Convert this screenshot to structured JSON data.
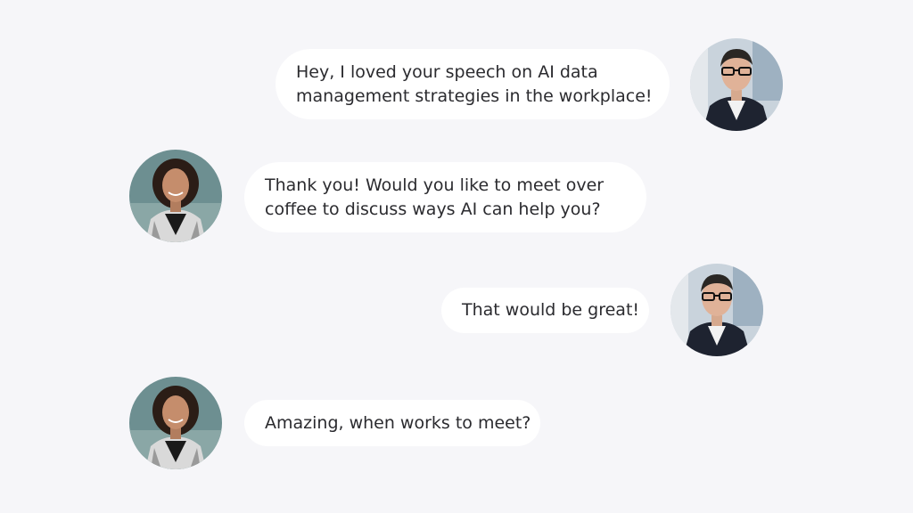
{
  "conversation": {
    "messages": [
      {
        "sender": "man",
        "lines": [
          "Hey, I loved your speech on AI data",
          "management strategies in the workplace!"
        ]
      },
      {
        "sender": "woman",
        "lines": [
          "Thank you! Would you like to meet over",
          "coffee to discuss ways AI can help you?"
        ]
      },
      {
        "sender": "man",
        "lines": [
          "That would be great!"
        ]
      },
      {
        "sender": "woman",
        "lines": [
          "Amazing, when works to meet?"
        ]
      }
    ]
  },
  "colors": {
    "background": "#f6f6f9",
    "bubble": "#ffffff",
    "text": "#2b2b2f"
  }
}
